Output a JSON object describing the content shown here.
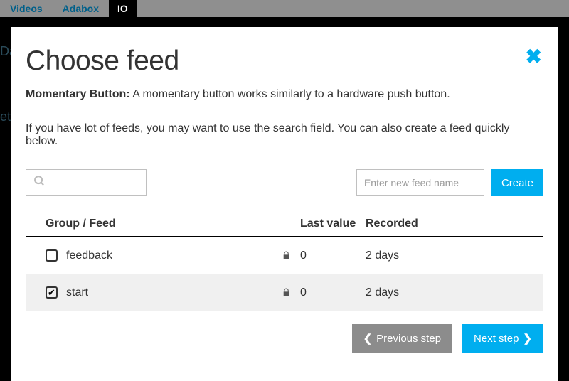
{
  "nav": {
    "items": [
      "Videos",
      "Adabox",
      "IO"
    ]
  },
  "background_fragments": {
    "da": "Da",
    "et": "et"
  },
  "modal": {
    "title": "Choose feed",
    "desc_bold": "Momentary Button:",
    "desc_rest": " A momentary button works similarly to a hardware push button.",
    "hint": "If you have lot of feeds, you may want to use the search field. You can also create a feed quickly below.",
    "search_placeholder": "",
    "newfeed_placeholder": "Enter new feed name",
    "create_label": "Create",
    "table": {
      "headers": {
        "group": "Group / Feed",
        "last": "Last value",
        "recorded": "Recorded"
      },
      "rows": [
        {
          "checked": false,
          "name": "feedback",
          "locked": true,
          "last_value": "0",
          "recorded": "2 days"
        },
        {
          "checked": true,
          "name": "start",
          "locked": true,
          "last_value": "0",
          "recorded": "2 days"
        }
      ]
    },
    "prev_label": "Previous step",
    "next_label": "Next step"
  }
}
